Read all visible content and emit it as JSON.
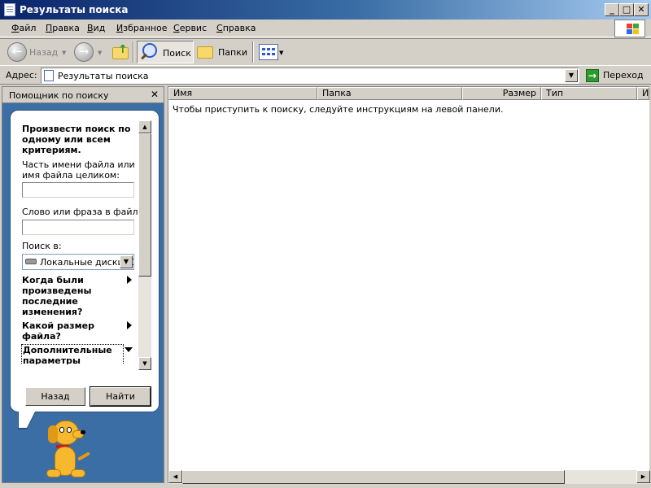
{
  "window": {
    "title": "Результаты поиска",
    "controls": {
      "minimize": "_",
      "maximize": "□",
      "close": "✕"
    }
  },
  "menu": [
    "Файл",
    "Правка",
    "Вид",
    "Избранное",
    "Сервис",
    "Справка"
  ],
  "toolbar": {
    "back_label": "Назад",
    "search_label": "Поиск",
    "folders_label": "Папки"
  },
  "address": {
    "label": "Адрес:",
    "value": "Результаты поиска",
    "go_label": "Переход"
  },
  "search_pane": {
    "header": "Помощник по поиску",
    "close_glyph": "✕",
    "intro": "Произвести поиск по одному или всем критериям.",
    "filename_label": "Часть имени файла или имя файла целиком:",
    "filename_value": "",
    "phrase_label": "Слово или фраза в файле:",
    "phrase_value": "",
    "lookin_label": "Поиск в:",
    "lookin_value": "Локальные диски (С",
    "option_modified": "Когда были произведены последние изменения?",
    "option_size": "Какой размер файла?",
    "option_advanced": "Дополнительные параметры",
    "back_button": "Назад",
    "search_button": "Найти"
  },
  "results": {
    "columns": [
      "Имя",
      "Папка",
      "Размер",
      "Тип",
      "И"
    ],
    "empty_message": "Чтобы приступить к поиску, следуйте инструкциям на левой панели."
  },
  "icons": {
    "back": "back-arrow-icon",
    "forward": "forward-arrow-icon",
    "up": "folder-up-icon",
    "search": "magnifier-icon",
    "folders": "folders-icon",
    "views": "views-icon",
    "go": "go-arrow-icon",
    "drive": "hard-drive-icon"
  },
  "colors": {
    "titlebar_start": "#0a246a",
    "pane_background": "#3a6ea5",
    "chrome": "#d4d0c8"
  }
}
